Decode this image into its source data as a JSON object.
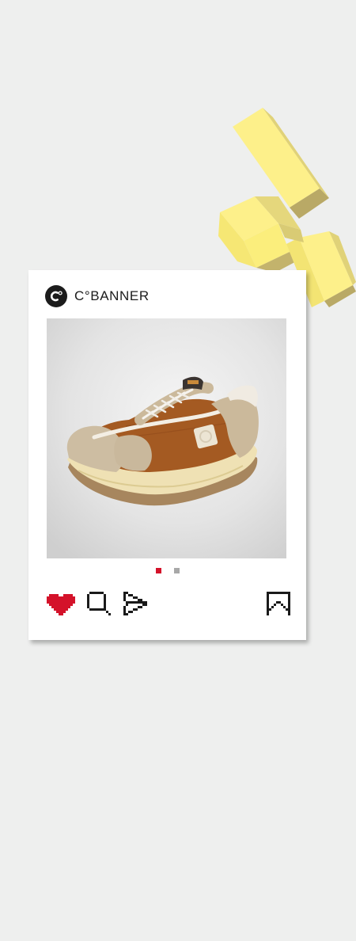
{
  "brand": {
    "name": "C°BANNER",
    "logo_icon": "c-degree-logo-icon",
    "logo_letter": "C"
  },
  "product": {
    "image_description_icon": "sneaker-image"
  },
  "pager": {
    "count": 2,
    "active_index": 0,
    "active_color": "#d4122a",
    "inactive_color": "#a8a8a8"
  },
  "actions": {
    "like_icon": "heart-icon",
    "like_color": "#d4122a",
    "search_icon": "search-icon",
    "share_icon": "share-arrow-icon",
    "bookmark_icon": "bookmark-icon"
  },
  "colors": {
    "background": "#eeefee",
    "card": "#ffffff",
    "deco_block_top": "#fdf08a",
    "deco_block_side": "#b9a966"
  }
}
